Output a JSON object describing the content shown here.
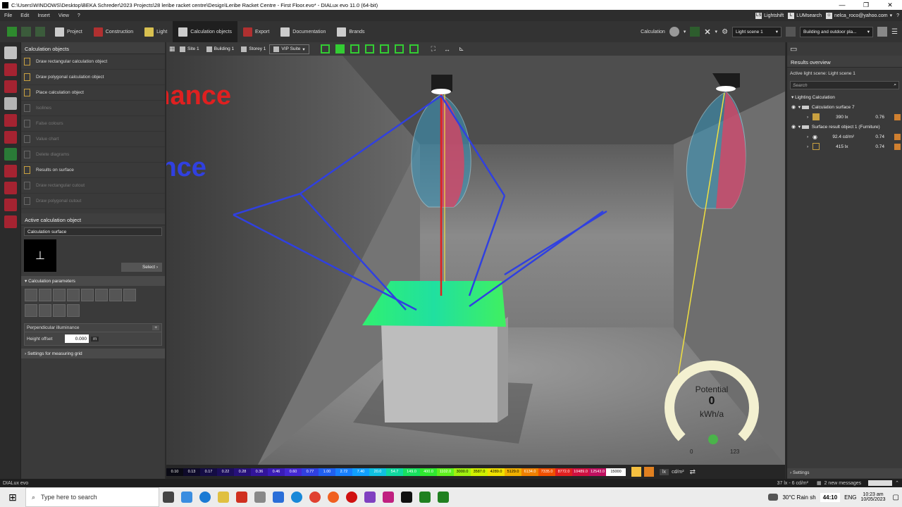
{
  "window": {
    "title": "C:\\Users\\WINDOWS\\Desktop\\BEKA Schreder\\2023 Projects\\28 leribe racket centre\\Design\\Leribe Racket Centre - First Floor.evo* - DIALux evo 11.0 (64-bit)"
  },
  "menu": {
    "items": [
      "File",
      "Edit",
      "Insert",
      "View",
      "?"
    ],
    "lightshift": "Lightshift",
    "lumsearch": "LUMsearch",
    "user": "nelca_roco@yahoo.com"
  },
  "toolbar": {
    "tabs": [
      "Project",
      "Construction",
      "Light",
      "Calculation objects",
      "Export",
      "Documentation",
      "Brands"
    ],
    "calculation_label": "Calculation",
    "light_scene": "Light scene 1",
    "building_mode": "Building and outdoor pla..."
  },
  "left_panel": {
    "title": "Calculation objects",
    "items": [
      {
        "label": "Draw rectangular calculation object",
        "enabled": true
      },
      {
        "label": "Draw polygonal calculation object",
        "enabled": true
      },
      {
        "label": "Place calculation object",
        "enabled": true
      },
      {
        "label": "Isolines",
        "enabled": false
      },
      {
        "label": "False colours",
        "enabled": false
      },
      {
        "label": "Value chart",
        "enabled": false
      },
      {
        "label": "Delete diagrams",
        "enabled": false
      },
      {
        "label": "Results on surface",
        "enabled": true
      },
      {
        "label": "Draw rectangular cutout",
        "enabled": false
      },
      {
        "label": "Draw polygonal cutout",
        "enabled": false
      }
    ],
    "active_title": "Active calculation object",
    "active_name": "Calculation surface",
    "select_label": "Select",
    "params_title": "Calculation parameters",
    "param_type": "Perpendicular illuminance",
    "height_offset_label": "Height offset",
    "height_offset_value": "0.000",
    "height_offset_unit": "m",
    "grid_settings": "Settings for measuring grid"
  },
  "viewport": {
    "breadcrumbs": [
      "Site 1",
      "Building 1",
      "Storey 1",
      "VIP Suite"
    ],
    "annotation_illuminance": "Illuminance",
    "annotation_luminance": "luminance",
    "gauge": {
      "label": "Potential",
      "value": "0",
      "unit": "kWh/a",
      "min": "0",
      "max": "123"
    }
  },
  "color_scale": {
    "values": [
      "0.10",
      "0.13",
      "0.17",
      "0.22",
      "0.28",
      "0.36",
      "0.46",
      "0.60",
      "0.77",
      "1.00",
      "2.72",
      "7.40",
      "20.0",
      "54.7",
      "149.0",
      "400.0",
      "1102.0",
      "3000.0",
      "3587.0",
      "4289.0",
      "5129.0",
      "6134.0",
      "7335.0",
      "8772.0",
      "10489.0",
      "12543.0",
      "15000"
    ],
    "colors": [
      "#0a0a14",
      "#0e0a2a",
      "#140c44",
      "#1c0e5c",
      "#26107a",
      "#32149a",
      "#3a1cb8",
      "#4428d4",
      "#3040e0",
      "#2060f0",
      "#1880ff",
      "#10a0ff",
      "#10c0e0",
      "#10d8a0",
      "#18e060",
      "#30e830",
      "#60f020",
      "#a0f010",
      "#d0f000",
      "#f0e000",
      "#f0b000",
      "#f08000",
      "#f05000",
      "#e02020",
      "#d01040",
      "#c01060",
      "#ffffff"
    ],
    "unit_lx": "lx",
    "unit_cdm": "cd/m²"
  },
  "results": {
    "title": "Results overview",
    "active_scene": "Active light scene: Light scene 1",
    "search_placeholder": "Search",
    "group": "Lighting Calculation",
    "surface": "Calculation surface 7",
    "surface_value": "390",
    "surface_unit": "lx",
    "surface_ratio": "0.76",
    "result_obj": "Surface result object 1 (Furniture)",
    "lum_value": "92.4",
    "lum_unit": "cd/m²",
    "lum_ratio": "0.74",
    "ill_value": "415",
    "ill_unit": "lx",
    "ill_ratio": "0.74",
    "settings": "Settings"
  },
  "status": {
    "app": "DIALux evo",
    "readout": "37 lx - 6 cd/m²",
    "messages": "2 new messages"
  },
  "taskbar": {
    "search_placeholder": "Type here to search",
    "weather": "30°C  Rain sh",
    "timer": "44:10",
    "lang": "ENG",
    "time": "10:23 am",
    "date": "10/05/2023"
  }
}
